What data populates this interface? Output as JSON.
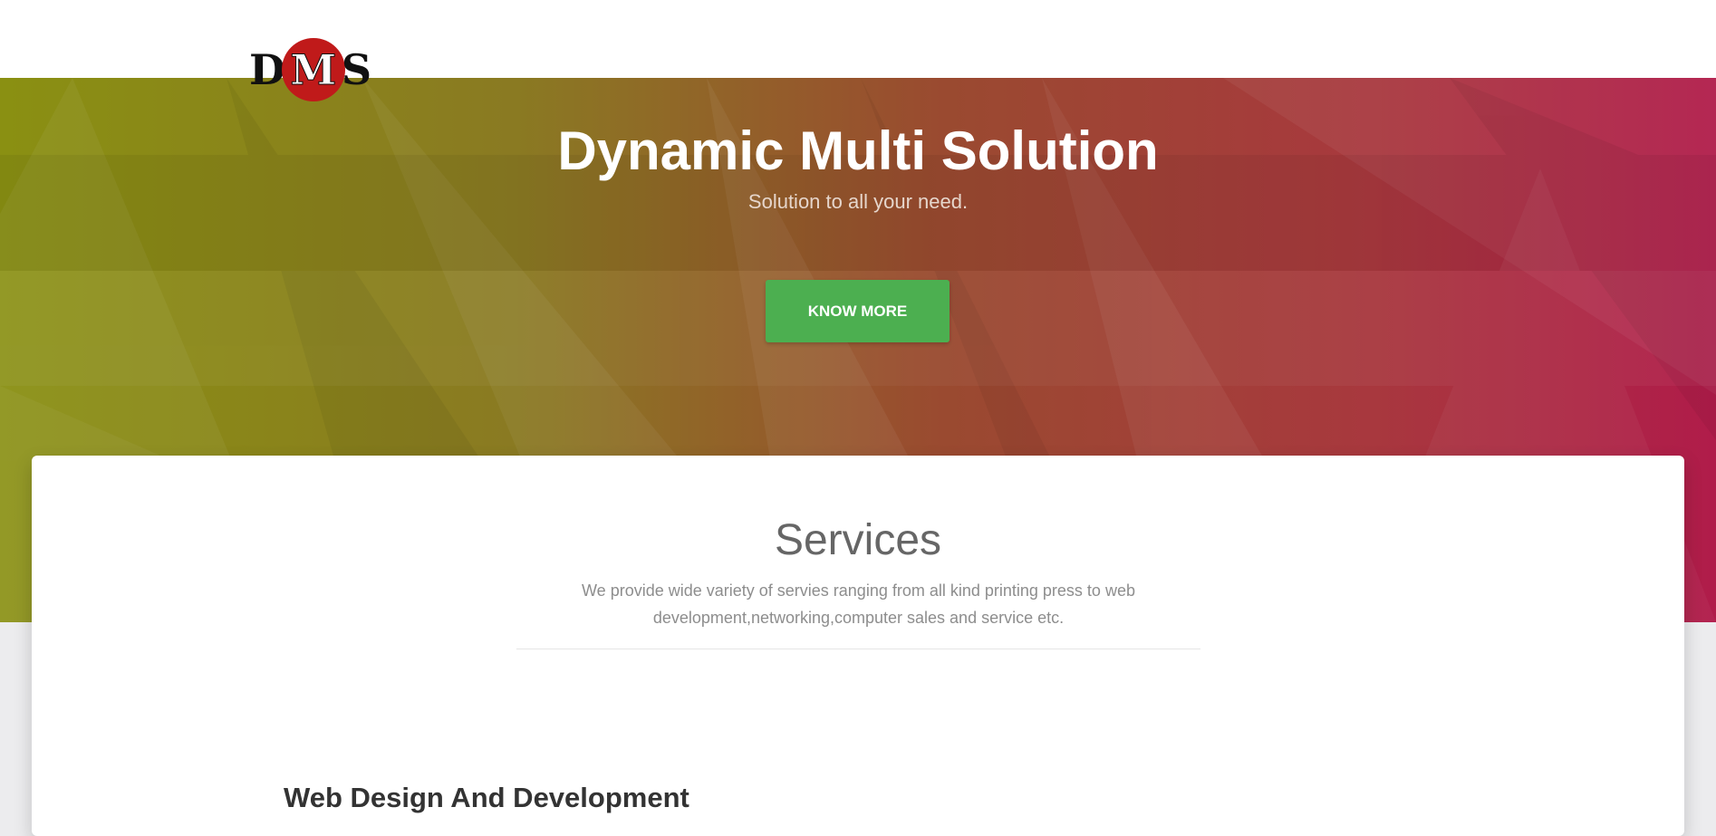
{
  "header": {
    "logo": {
      "letter_1": "D",
      "letter_2": "M",
      "letter_3": "S"
    }
  },
  "hero": {
    "title": "Dynamic Multi Solution",
    "subtitle": "Solution to all your need.",
    "cta_label": "KNOW MORE"
  },
  "services": {
    "title": "Services",
    "description": "We provide wide variety of servies ranging from all kind printing press to web development,networking,computer sales and service etc.",
    "first_service_title": "Web Design And Development"
  },
  "colors": {
    "cta_button": "#4caf50",
    "logo_circle": "#c01a1a",
    "hero_left": "#8a9012",
    "hero_right": "#b01c4a"
  }
}
